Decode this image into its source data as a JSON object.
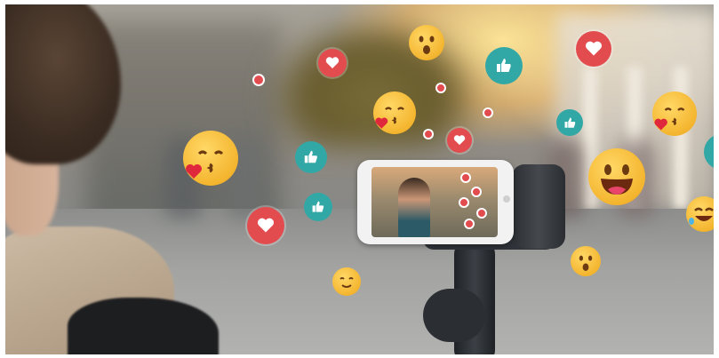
{
  "image": {
    "scene": "street-livestream-photo",
    "icons": {
      "heart": "heart-icon",
      "like": "thumbs-up-icon",
      "kiss": "kissing-face-icon",
      "surprised": "surprised-face-icon",
      "laughing": "laughing-face-icon",
      "tears": "tears-of-joy-icon",
      "smiling": "smiling-face-icon"
    },
    "colors": {
      "heart_badge": "#e34c4f",
      "like_badge": "#32a8a6",
      "emoji_yellow": "#f4b52f",
      "gimbal": "#2c2f33",
      "phone_body": "#f2f2f2"
    }
  }
}
